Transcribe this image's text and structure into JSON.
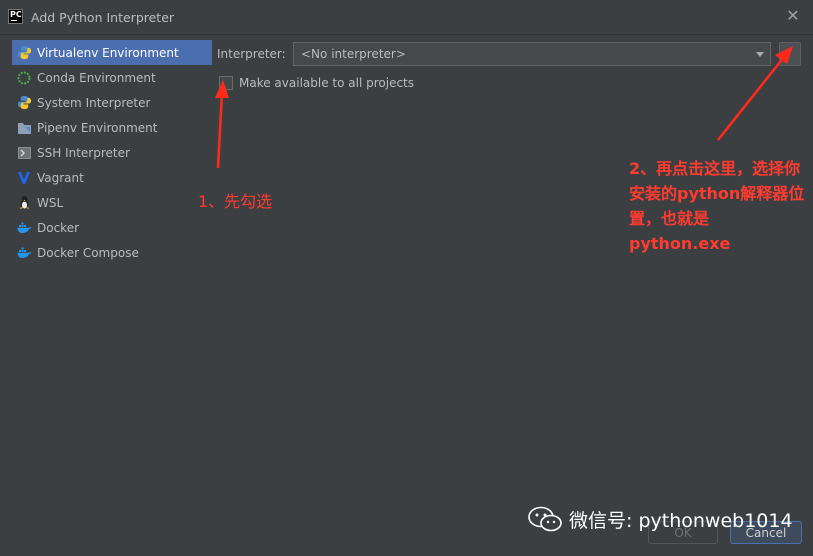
{
  "window": {
    "title": "Add Python Interpreter",
    "app_icon": "PC",
    "close": "✕"
  },
  "sidebar": {
    "items": [
      {
        "label": "Virtualenv Environment",
        "icon": "virtualenv-icon",
        "selected": true
      },
      {
        "label": "Conda Environment",
        "icon": "conda-icon"
      },
      {
        "label": "System Interpreter",
        "icon": "python-icon"
      },
      {
        "label": "Pipenv Environment",
        "icon": "pipenv-icon"
      },
      {
        "label": "SSH Interpreter",
        "icon": "ssh-icon"
      },
      {
        "label": "Vagrant",
        "icon": "vagrant-icon"
      },
      {
        "label": "WSL",
        "icon": "linux-icon"
      },
      {
        "label": "Docker",
        "icon": "docker-icon"
      },
      {
        "label": "Docker Compose",
        "icon": "docker-icon"
      }
    ]
  },
  "form": {
    "interpreter_label": "Interpreter:",
    "interpreter_value": "<No interpreter>",
    "make_available_label": "Make available to all projects",
    "make_available_checked": false
  },
  "annotations": {
    "step1": "1、先勾选",
    "step2": "2、再点击这里，选择你安装的python解释器位置，也就是python.exe"
  },
  "buttons": {
    "ok": "OK",
    "cancel": "Cancel"
  },
  "watermark": {
    "text": "微信号: pythonweb1014"
  },
  "colors": {
    "selection": "#4b6eaf",
    "background": "#3c3f41",
    "annotation": "#ff3b30"
  }
}
